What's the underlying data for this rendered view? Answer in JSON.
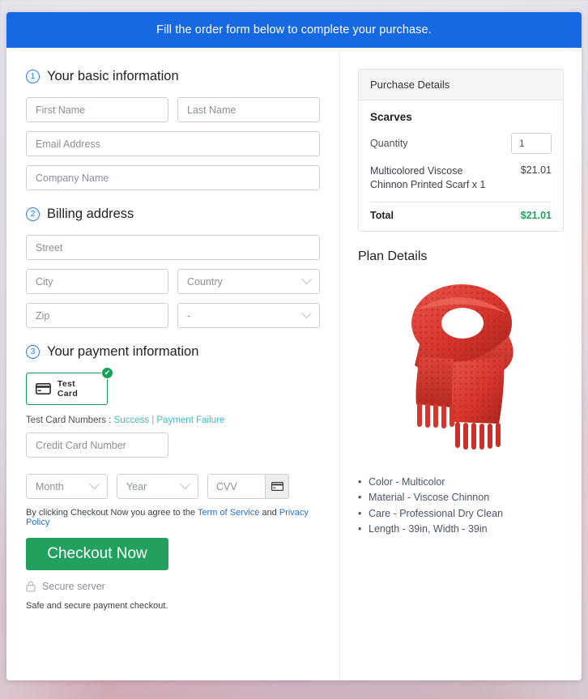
{
  "banner": {
    "text": "Fill the order form below to complete your purchase."
  },
  "steps": {
    "basic": {
      "num": "1",
      "title": "Your basic information"
    },
    "billing": {
      "num": "2",
      "title": "Billing address"
    },
    "payment": {
      "num": "3",
      "title": "Your payment information"
    }
  },
  "fields": {
    "first_name": "First Name",
    "last_name": "Last Name",
    "email": "Email Address",
    "company": "Company Name",
    "street": "Street",
    "city": "City",
    "country": "Country",
    "zip": "Zip",
    "state": "-",
    "card_number": "Credit Card Number",
    "month": "Month",
    "year": "Year",
    "cvv": "CVV"
  },
  "payment_method": {
    "label": "Test Card",
    "icon": "credit-card-icon",
    "selected_mark": "✔"
  },
  "test_numbers": {
    "prefix": "Test Card Numbers : ",
    "success": "Success",
    "separator": " | ",
    "failure": "Payment Failure"
  },
  "terms": {
    "before": "By clicking Checkout Now you agree to the ",
    "tos": "Term of Service",
    "middle": " and ",
    "privacy": "Privacy Policy"
  },
  "checkout": {
    "label": "Checkout Now"
  },
  "secure": {
    "icon": "lock-icon",
    "label": "Secure server"
  },
  "safe_note": "Safe and secure payment checkout.",
  "purchase": {
    "heading": "Purchase Details",
    "product": "Scarves",
    "quantity_label": "Quantity",
    "quantity_value": "1",
    "line_item": "Multicolored Viscose Chinnon Printed Scarf x 1",
    "line_price": "$21.01",
    "total_label": "Total",
    "total_value": "$21.01"
  },
  "plan": {
    "heading": "Plan Details",
    "image_name": "red-knitted-scarf-photo",
    "bullets": [
      "Color - Multicolor",
      "Material - Viscose Chinnon",
      "Care - Professional Dry Clean",
      "Length - 39in, Width - 39in"
    ]
  },
  "colors": {
    "banner_blue": "#1668e3",
    "accent_blue": "#2b7cf0",
    "green": "#21a05e",
    "teal_link": "#3fb8c4",
    "scarf_red": "#d6352c"
  }
}
